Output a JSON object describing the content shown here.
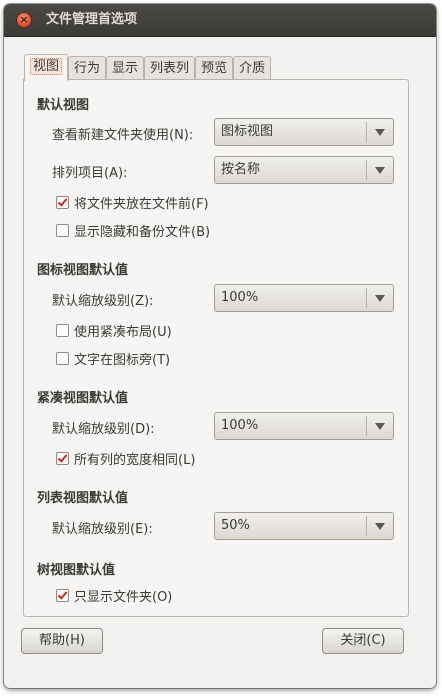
{
  "window": {
    "title": "文件管理首选项"
  },
  "tabs": [
    "视图",
    "行为",
    "显示",
    "列表列",
    "预览",
    "介质"
  ],
  "default_view": {
    "heading": "默认视图",
    "new_folder_label": "查看新建文件夹使用(N):",
    "new_folder_value": "图标视图",
    "arrange_label": "排列项目(A):",
    "arrange_value": "按名称",
    "folders_first_label": "将文件夹放在文件前(F)",
    "folders_first_checked": true,
    "show_hidden_label": "显示隐藏和备份文件(B)",
    "show_hidden_checked": false
  },
  "icon_view": {
    "heading": "图标视图默认值",
    "zoom_label": "默认缩放级别(Z):",
    "zoom_value": "100%",
    "compact_label": "使用紧凑布局(U)",
    "compact_checked": false,
    "text_beside_label": "文字在图标旁(T)",
    "text_beside_checked": false
  },
  "compact_view": {
    "heading": "紧凑视图默认值",
    "zoom_label": "默认缩放级别(D):",
    "zoom_value": "100%",
    "same_width_label": "所有列的宽度相同(L)",
    "same_width_checked": true
  },
  "list_view": {
    "heading": "列表视图默认值",
    "zoom_label": "默认缩放级别(E):",
    "zoom_value": "50%"
  },
  "tree_view": {
    "heading": "树视图默认值",
    "folders_only_label": "只显示文件夹(O)",
    "folders_only_checked": true
  },
  "buttons": {
    "help": "帮助(H)",
    "close": "关闭(C)"
  },
  "colors": {
    "accent": "#dc4e29",
    "titlebar": "#3c3b37"
  }
}
